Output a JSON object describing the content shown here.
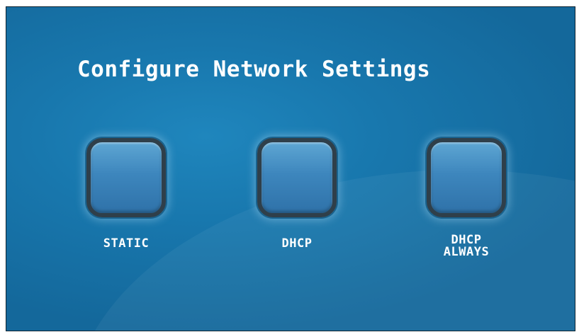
{
  "screen": {
    "title": "Configure Network Settings"
  },
  "options": [
    {
      "label_lines": [
        "STATIC"
      ]
    },
    {
      "label_lines": [
        "DHCP"
      ]
    },
    {
      "label_lines": [
        "DHCP",
        "ALWAYS"
      ]
    }
  ],
  "colors": {
    "background": "#1877ad",
    "button_fill": "#3d86bd",
    "button_border": "#2f3f4a",
    "text": "#ffffff"
  }
}
